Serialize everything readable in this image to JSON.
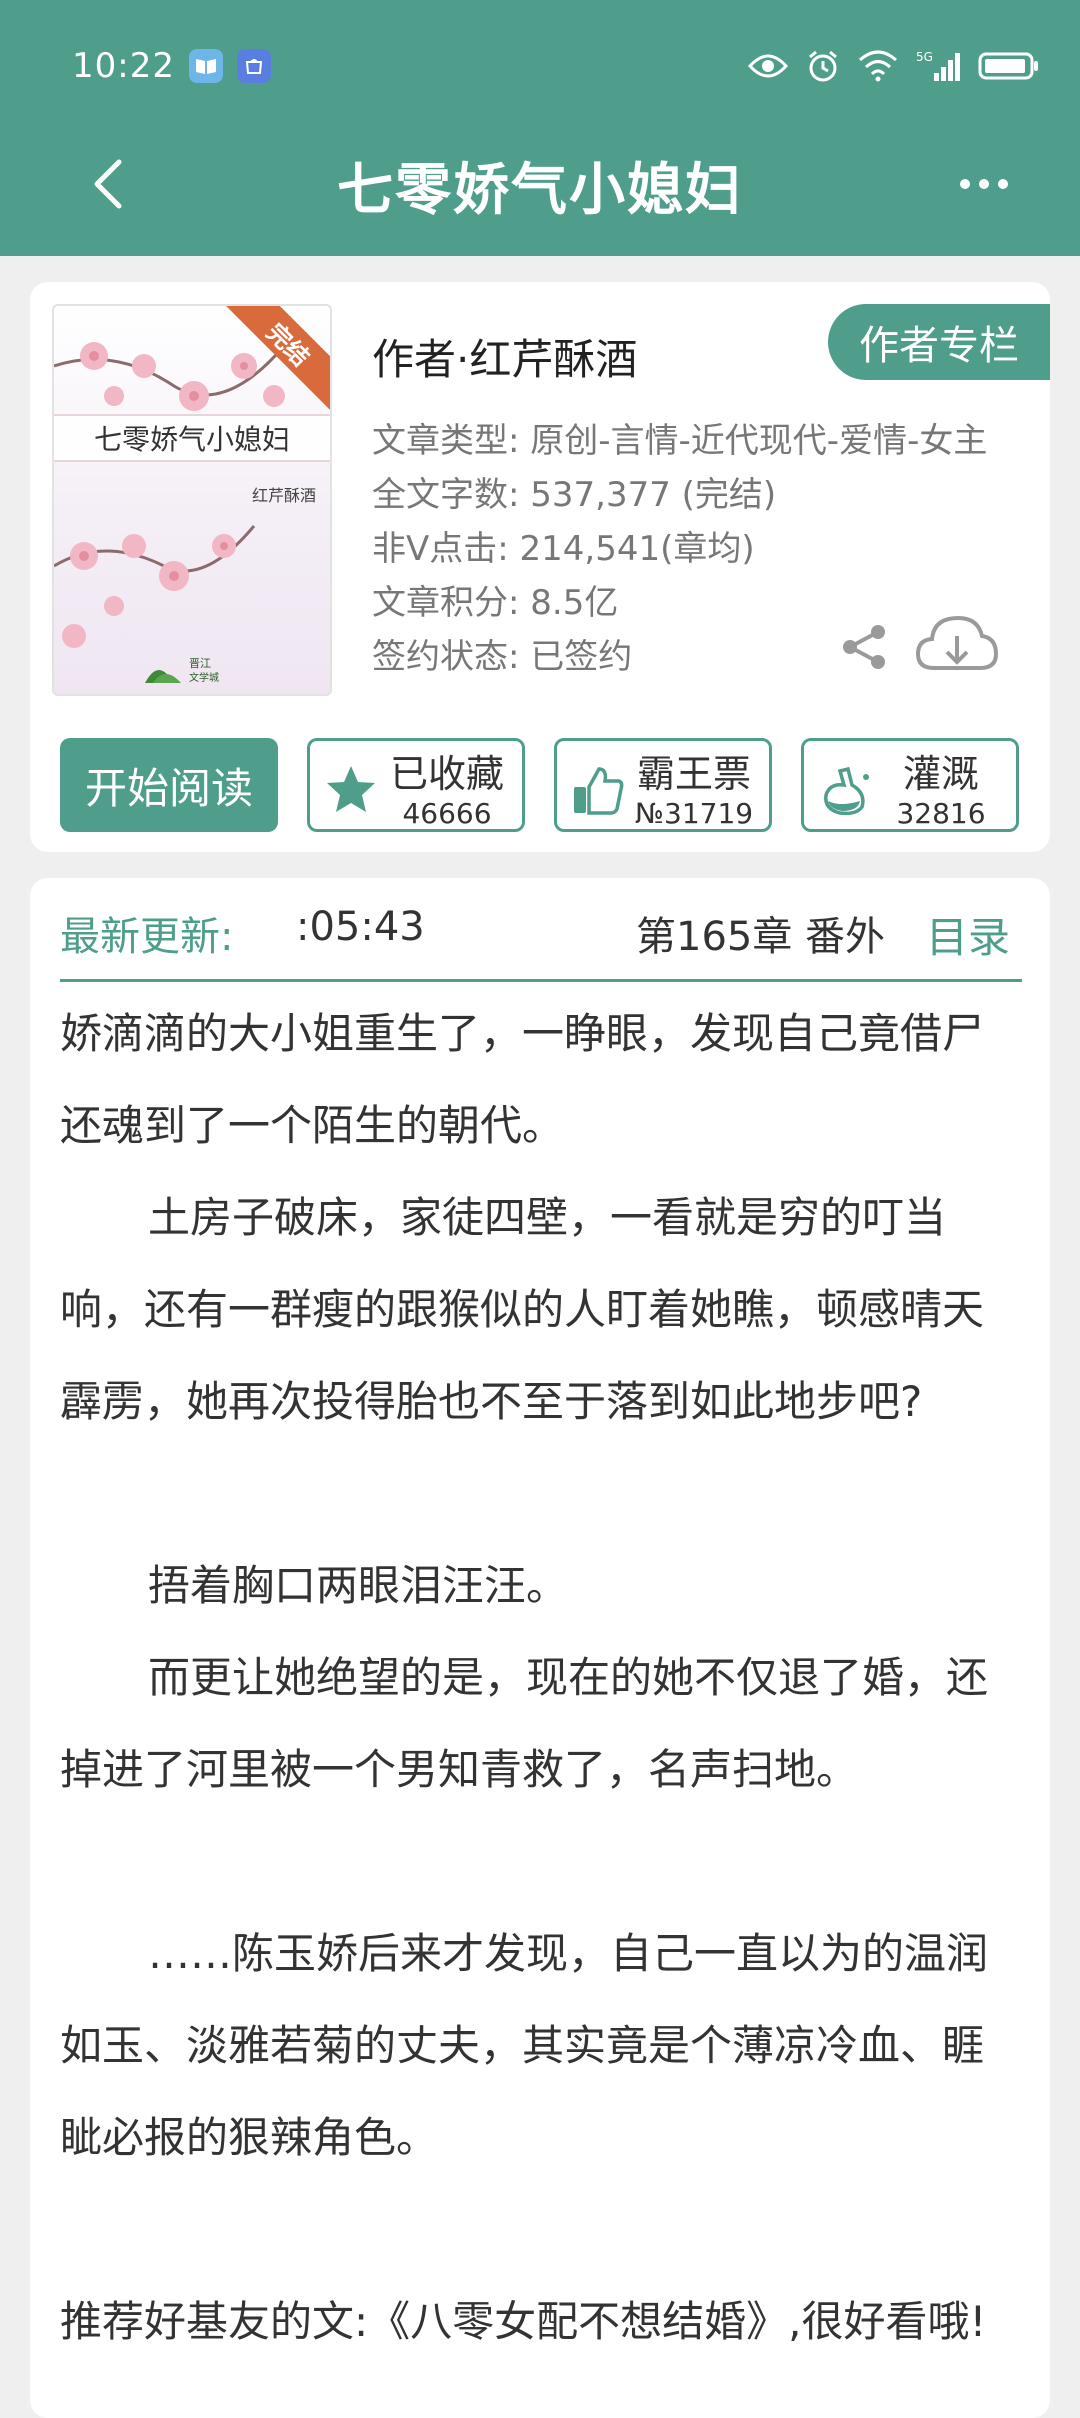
{
  "status_bar": {
    "time": "10:22"
  },
  "header": {
    "title": "七零娇气小媳妇"
  },
  "book": {
    "cover_title": "七零娇气小媳妇",
    "cover_author": "红芹酥酒",
    "cover_ribbon": "完结",
    "author_line": "作者·红芹酥酒",
    "author_column_label": "作者专栏",
    "meta": [
      "文章类型: 原创-言情-近代现代-爱情-女主",
      "全文字数: 537,377 (完结)",
      "非V点击: 214,541(章均)",
      "文章积分: 8.5亿",
      "签约状态: 已签约"
    ]
  },
  "actions": {
    "read_label": "开始阅读",
    "collect_label": "已收藏",
    "collect_count": "46666",
    "vote_label": "霸王票",
    "vote_count": "№31719",
    "water_label": "灌溉",
    "water_count": "32816"
  },
  "update": {
    "label": "最新更新:",
    "time": ":05:43",
    "chapter": "第165章  番外",
    "toc_label": "目录"
  },
  "intro": [
    {
      "text": "娇滴滴的大小姐重生了，一睁眼，发现自己竟借尸还魂到了一个陌生的朝代。",
      "indent": false
    },
    {
      "text": "土房子破床，家徒四壁，一看就是穷的叮当响，还有一群瘦的跟猴似的人盯着她瞧，顿感晴天霹雳，她再次投得胎也不至于落到如此地步吧?",
      "indent": true
    },
    {
      "text": "",
      "indent": false
    },
    {
      "text": "捂着胸口两眼泪汪汪。",
      "indent": true
    },
    {
      "text": "而更让她绝望的是，现在的她不仅退了婚，还掉进了河里被一个男知青救了，名声扫地。",
      "indent": true
    },
    {
      "text": "",
      "indent": false
    },
    {
      "text": "……陈玉娇后来才发现，自己一直以为的温润如玉、淡雅若菊的丈夫，其实竟是个薄凉冷血、睚眦必报的狠辣角色。",
      "indent": true
    },
    {
      "text": "",
      "indent": false
    },
    {
      "text": "推荐好基友的文:《八零女配不想结婚》,很好看哦!",
      "indent": false
    }
  ]
}
